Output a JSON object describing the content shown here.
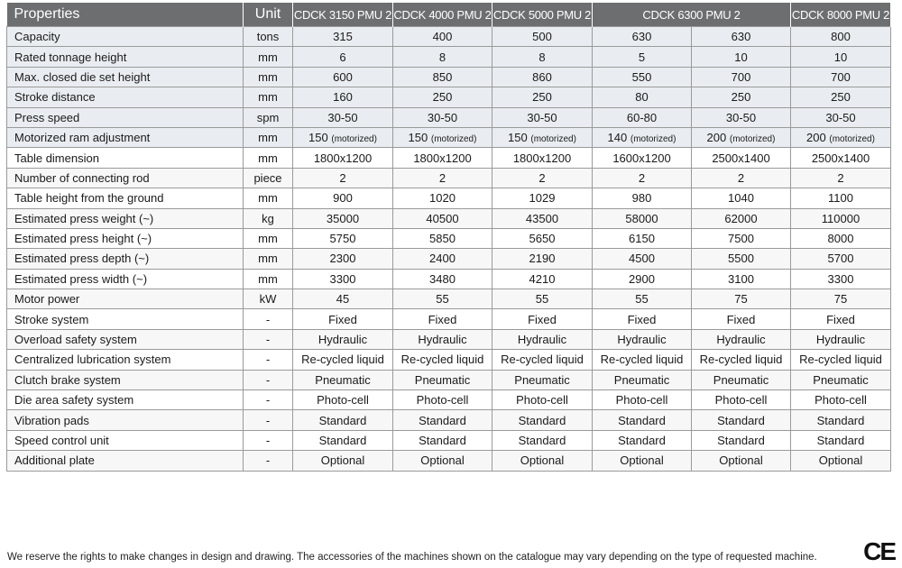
{
  "table": {
    "header": [
      "Properties",
      "Unit",
      "CDCK 3150 PMU 2",
      "CDCK 4000 PMU 2",
      "CDCK 5000 PMU 2",
      "CDCK 6300 PMU 2",
      "CDCK 8000 PMU 2"
    ],
    "rows": [
      {
        "property": "Capacity",
        "unit": "tons",
        "values": [
          "315",
          "400",
          "500",
          "630",
          "630",
          "800"
        ]
      },
      {
        "property": "Rated tonnage height",
        "unit": "mm",
        "values": [
          "6",
          "8",
          "8",
          "5",
          "10",
          "10"
        ]
      },
      {
        "property": "Max. closed die set height",
        "unit": "mm",
        "values": [
          "600",
          "850",
          "860",
          "550",
          "700",
          "700"
        ]
      },
      {
        "property": "Stroke distance",
        "unit": "mm",
        "values": [
          "160",
          "250",
          "250",
          "80",
          "250",
          "250"
        ]
      },
      {
        "property": "Press speed",
        "unit": "spm",
        "values": [
          "30-50",
          "30-50",
          "30-50",
          "60-80",
          "30-50",
          "30-50"
        ]
      },
      {
        "property": "Motorized ram adjustment",
        "unit": "mm",
        "values": [
          "150",
          "150",
          "150",
          "140",
          "200",
          "200"
        ],
        "value_note": "(motorized)"
      },
      {
        "property": "Table dimension",
        "unit": "mm",
        "values": [
          "1800x1200",
          "1800x1200",
          "1800x1200",
          "1600x1200",
          "2500x1400",
          "2500x1400"
        ]
      },
      {
        "property": "Number of connecting rod",
        "unit": "piece",
        "values": [
          "2",
          "2",
          "2",
          "2",
          "2",
          "2"
        ]
      },
      {
        "property": "Table height from the ground",
        "unit": "mm",
        "values": [
          "900",
          "1020",
          "1029",
          "980",
          "1040",
          "1100"
        ]
      },
      {
        "property": "Estimated press weight  (~)",
        "unit": "kg",
        "values": [
          "35000",
          "40500",
          "43500",
          "58000",
          "62000",
          "110000"
        ]
      },
      {
        "property": "Estimated press height  (~)",
        "unit": "mm",
        "values": [
          "5750",
          "5850",
          "5650",
          "6150",
          "7500",
          "8000"
        ]
      },
      {
        "property": "Estimated press depth  (~)",
        "unit": "mm",
        "values": [
          "2300",
          "2400",
          "2190",
          "4500",
          "5500",
          "5700"
        ]
      },
      {
        "property": "Estimated press width   (~)",
        "unit": "mm",
        "values": [
          "3300",
          "3480",
          "4210",
          "2900",
          "3100",
          "3300"
        ]
      },
      {
        "property": "Motor power",
        "unit": "kW",
        "values": [
          "45",
          "55",
          "55",
          "55",
          "75",
          "75"
        ]
      },
      {
        "property": "Stroke system",
        "unit": "-",
        "values": [
          "Fixed",
          "Fixed",
          "Fixed",
          "Fixed",
          "Fixed",
          "Fixed"
        ]
      },
      {
        "property": "Overload safety system",
        "unit": "-",
        "values": [
          "Hydraulic",
          "Hydraulic",
          "Hydraulic",
          "Hydraulic",
          "Hydraulic",
          "Hydraulic"
        ]
      },
      {
        "property": "Centralized lubrication system",
        "unit": "-",
        "values": [
          "Re-cycled liquid",
          "Re-cycled liquid",
          "Re-cycled liquid",
          "Re-cycled liquid",
          "Re-cycled liquid",
          "Re-cycled liquid"
        ]
      },
      {
        "property": "Clutch brake system",
        "unit": "-",
        "values": [
          "Pneumatic",
          "Pneumatic",
          "Pneumatic",
          "Pneumatic",
          "Pneumatic",
          "Pneumatic"
        ]
      },
      {
        "property": "Die area safety system",
        "unit": "-",
        "values": [
          "Photo-cell",
          "Photo-cell",
          "Photo-cell",
          "Photo-cell",
          "Photo-cell",
          "Photo-cell"
        ]
      },
      {
        "property": "Vibration pads",
        "unit": "-",
        "values": [
          "Standard",
          "Standard",
          "Standard",
          "Standard",
          "Standard",
          "Standard"
        ]
      },
      {
        "property": "Speed control unit",
        "unit": "-",
        "values": [
          "Standard",
          "Standard",
          "Standard",
          "Standard",
          "Standard",
          "Standard"
        ]
      },
      {
        "property": "Additional plate",
        "unit": "-",
        "values": [
          "Optional",
          "Optional",
          "Optional",
          "Optional",
          "Optional",
          "Optional"
        ]
      }
    ]
  },
  "footer": "We reserve the rights to make changes in design and drawing. The accessories of the machines shown on the catalogue may vary depending on the type of requested machine.",
  "ce_mark": "CE",
  "colors": {
    "header_bg": "#6d6e70",
    "border": "#9a9a9a"
  }
}
